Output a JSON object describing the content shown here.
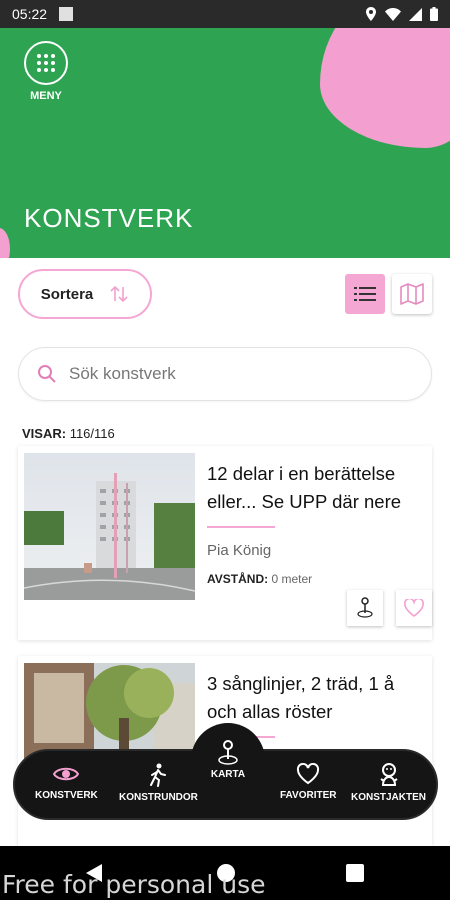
{
  "status_bar": {
    "time": "05:22"
  },
  "header": {
    "menu_label": "MENY",
    "title": "KONSTVERK"
  },
  "toolbar": {
    "sort_label": "Sortera"
  },
  "search": {
    "placeholder": "Sök konstverk"
  },
  "results": {
    "label": "VISAR:",
    "value": "116/116"
  },
  "cards": [
    {
      "title": "12 delar i en berättelse eller... Se UPP där nere",
      "artist": "Pia König",
      "distance_label": "AVSTÅND:",
      "distance_value": "0 meter"
    },
    {
      "title": "3 sånglinjer, 2 träd, 1 å och allas röster"
    }
  ],
  "bottom_nav": {
    "items": [
      {
        "label": "KONSTVERK",
        "icon": "eye-icon"
      },
      {
        "label": "KONSTRUNDOR",
        "icon": "walking-icon"
      },
      {
        "label": "KARTA",
        "icon": "pin-icon"
      },
      {
        "label": "FAVORITER",
        "icon": "heart-icon"
      },
      {
        "label": "KONSTJAKTEN",
        "icon": "character-icon"
      }
    ]
  },
  "watermark": "Free for personal use",
  "colors": {
    "accent_pink": "#f5a7d3",
    "brand_green": "#2ea352",
    "nav_dark": "#151515"
  }
}
